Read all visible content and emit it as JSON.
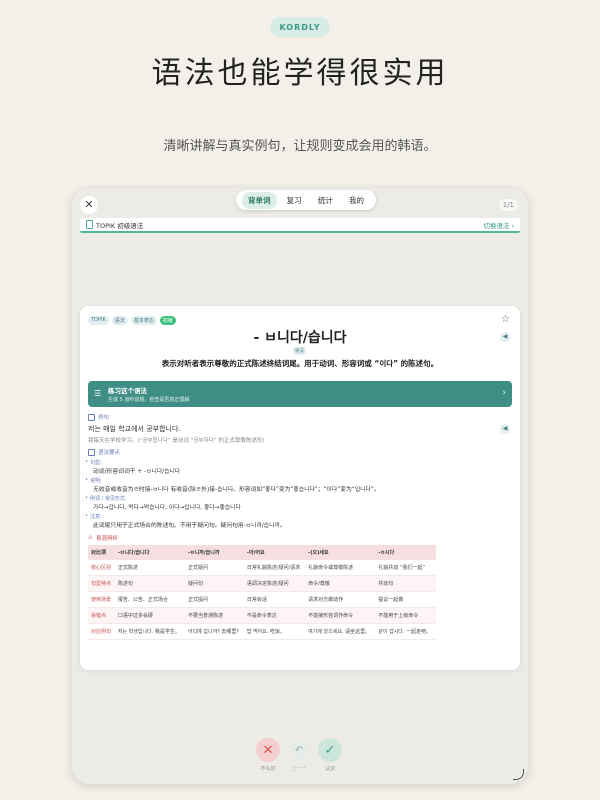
{
  "brand": "KORDLY",
  "headline": "语法也能学得很实用",
  "subline": "清晰讲解与真实例句，让规则变成会用的韩语。",
  "app": {
    "tabs": [
      {
        "label": "背单词",
        "active": true
      },
      {
        "label": "复习",
        "active": false
      },
      {
        "label": "统计",
        "active": false
      },
      {
        "label": "我的",
        "active": false
      }
    ],
    "pager": "1/1",
    "level_bar": {
      "title": "TOPIK 初级语法",
      "action": "切换语法 ›"
    }
  },
  "card": {
    "tags": [
      "TOPIK",
      "语法",
      "基本表达",
      "初级"
    ],
    "title": "- ㅂ니다/습니다",
    "pill": "语法",
    "desc": "表示对听者表示尊敬的正式陈述终结词尾。用于动词、形容词或 “이다” 的陈述句。",
    "practice": {
      "title": "练习这个语法",
      "subtitle": "生成 5 道听说题，检查是否真正理解"
    },
    "example": {
      "head": "例句",
      "ko": "저는 매일 학교에서 공부합니다.",
      "zh": "我每天在学校学习。(“공부합니다” 是动词 “공부하다” 的正式尊敬陈述形)"
    },
    "points": {
      "head": "语法要点",
      "items": [
        {
          "label": "句型:",
          "text": "动词/形容词词干 + -ㅂ니다/습니다"
        },
        {
          "label": "说明:",
          "text": "无收音或收音为ㄹ时接-ㅂ니다 有收音(除ㄹ外)接-습니다。形容词如“좋다”变为“좋습니다”；“이다”变为“입니다”。"
        },
        {
          "label": "例词 / 常见形式:",
          "text": "가다→갑니다, 먹다→먹습니다, 이다→입니다, 좋다→좋습니다"
        },
        {
          "label": "注意:",
          "text": "此词尾只用于正式场合的陈述句。不用于疑问句。疑问句用-ㅂ니까/습니까。"
        }
      ]
    },
    "compare": {
      "head": "易混辨析",
      "headers": [
        "对比项",
        "-ㅂ니다/습니다",
        "-ㅂ니까/습니까",
        "-아/어요",
        "-(으)세요",
        "-ㅂ시다"
      ],
      "rows": [
        [
          "核心区别",
          "正式陈述",
          "正式疑问",
          "日常礼貌陈述/疑问/请求",
          "礼貌命令或尊敬陈述",
          "礼貌共动 “我们一起”"
        ],
        [
          "句型特点",
          "陈述句",
          "疑问句",
          "语调决定陈述/疑问",
          "命令/尊敬",
          "共动句"
        ],
        [
          "使用场景",
          "报告、公告、正式场合",
          "正式提问",
          "日常会话",
          "请求对方做动作",
          "提议一起做"
        ],
        [
          "易错点",
          "口语中过多会硬",
          "不要当普通陈述",
          "不是命令表达",
          "不能接形容词作命令",
          "不能用于上级命令"
        ],
        [
          "对应例句",
          "저는 학생입니다. 我是学生。",
          "어디에 갑니까? 去哪里?",
          "밥 먹어요. 吃饭。",
          "여기에 앉으세요. 请坐这里。",
          "같이 갑시다. 一起走吧。"
        ]
      ]
    }
  },
  "controls": {
    "forget": "不认识",
    "undo": "上一个",
    "know": "认识"
  }
}
